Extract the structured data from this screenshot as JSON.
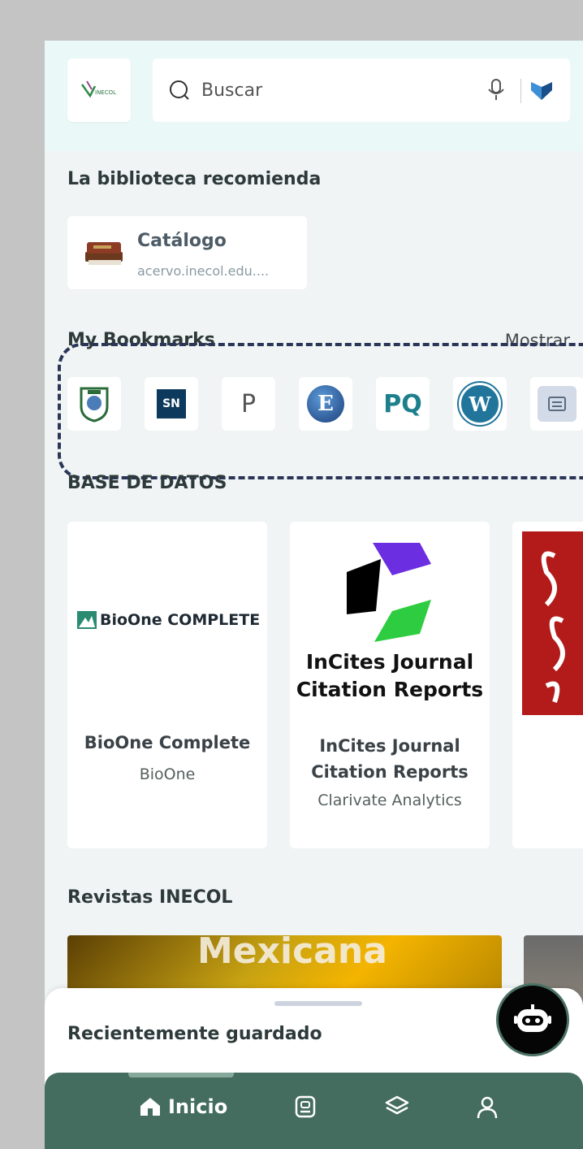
{
  "search": {
    "placeholder": "Buscar"
  },
  "recommend": {
    "title": "La biblioteca recomienda",
    "catalog": {
      "title": "Catálogo",
      "url": "acervo.inecol.edu...."
    }
  },
  "bookmarks": {
    "title": "My Bookmarks",
    "show_label": "Mostrar",
    "items": [
      {
        "name": "seal"
      },
      {
        "label": "SN"
      },
      {
        "label": "P"
      },
      {
        "label": "E"
      },
      {
        "label": "PQ"
      },
      {
        "label": "W"
      },
      {
        "name": "reader"
      }
    ]
  },
  "databases": {
    "title": "BASE DE DATOS",
    "cards": [
      {
        "logo_text": "BioOne COMPLETE",
        "name": "BioOne Complete",
        "publisher": "BioOne"
      },
      {
        "logo_line1": "InCites Journal",
        "logo_line2": "Citation Reports",
        "name_line1": "InCites Journal",
        "name_line2": "Citation Reports",
        "publisher": "Clarivate Analytics"
      }
    ]
  },
  "journals": {
    "title": "Revistas INECOL",
    "cover_text": "Mexicana"
  },
  "recent": {
    "title": "Recientemente guardado"
  },
  "nav": {
    "home_label": "Inicio",
    "colors": {
      "bar": "#446d5f",
      "accent": "#86a89b"
    }
  },
  "colors": {
    "dash": "#2a3558",
    "header": "#eaf8f7"
  }
}
